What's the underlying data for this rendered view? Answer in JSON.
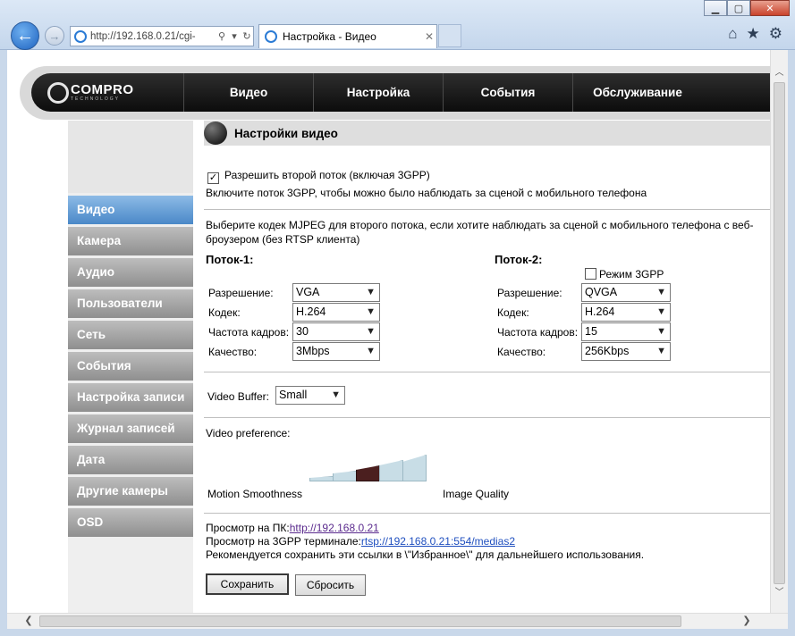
{
  "browser": {
    "address": "http://192.168.0.21/cgi-",
    "address_host": "192.168.0.21",
    "tab_title": "Настройка - Видео",
    "search_icon": "search-icon",
    "refresh_icon": "refresh-icon"
  },
  "header": {
    "brand": "COMPRO",
    "brand_sub": "TECHNOLOGY",
    "menu": [
      "Видео",
      "Настройка",
      "События",
      "Обслуживание"
    ]
  },
  "sidebar": {
    "items": [
      "Видео",
      "Камера",
      "Аудио",
      "Пользователи",
      "Сеть",
      "События",
      "Настройка записи",
      "Журнал записей",
      "Дата",
      "Другие камеры",
      "OSD"
    ],
    "active": 0
  },
  "page": {
    "title": "Настройки видео",
    "enable_second_stream": "Разрешить второй поток (включая 3GPP)",
    "enable_second_stream_checked": true,
    "enable_hint": "Включите поток 3GPP, чтобы можно было наблюдать за сценой с мобильного телефона",
    "mjpeg_hint_1": "Выберите кодек MJPEG для второго потока, если хотите наблюдать за сценой с мобильного телефона с веб-",
    "mjpeg_hint_2": "броузером (без RTSP клиента)",
    "stream1_title": "Поток-1:",
    "stream2_title": "Поток-2:",
    "mode_3gpp": "Режим 3GPP",
    "mode_3gpp_checked": false,
    "labels": {
      "resolution": "Разрешение:",
      "codec": "Кодек:",
      "framerate": "Частота кадров:",
      "quality": "Качество:"
    },
    "stream1": {
      "resolution": "VGA",
      "codec": "H.264",
      "framerate": "30",
      "quality": "3Mbps"
    },
    "stream2": {
      "resolution": "QVGA",
      "codec": "H.264",
      "framerate": "15",
      "quality": "256Kbps"
    },
    "video_buffer_label": "Video Buffer:",
    "video_buffer_value": "Small",
    "video_pref_label": "Video preference:",
    "pref_left": "Motion Smoothness",
    "pref_right": "Image Quality",
    "pref_levels": 5,
    "pref_selected": 3,
    "view_pc_label": "Просмотр на ПК:",
    "view_pc_url": "http://192.168.0.21",
    "view_3gpp_label": "Просмотр на 3GPP терминале:",
    "view_3gpp_url": "rtsp://192.168.0.21:554/medias2",
    "save_hint": "Рекомендуется сохранить эти ссылки в \\\"Избранное\\\" для дальнейшего использования.",
    "save_button": "Сохранить",
    "reset_button": "Сбросить"
  },
  "colors": {
    "active_nav": "#4a88c8",
    "nav": "#8f8f8f",
    "selected_bar": "#4b1f1f",
    "bar": "#c8dde6"
  }
}
